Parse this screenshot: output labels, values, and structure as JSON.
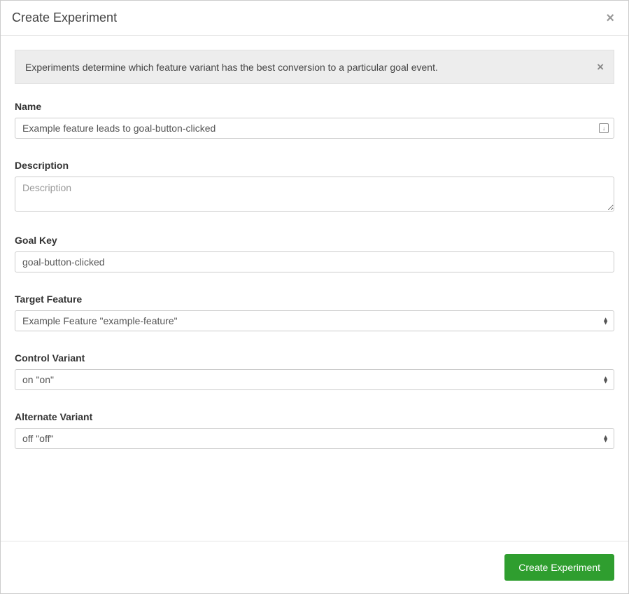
{
  "modal": {
    "title": "Create Experiment"
  },
  "banner": {
    "text": "Experiments determine which feature variant has the best conversion to a particular goal event."
  },
  "form": {
    "name": {
      "label": "Name",
      "value": "Example feature leads to goal-button-clicked"
    },
    "description": {
      "label": "Description",
      "placeholder": "Description",
      "value": ""
    },
    "goalKey": {
      "label": "Goal Key",
      "value": "goal-button-clicked"
    },
    "targetFeature": {
      "label": "Target Feature",
      "value": "Example Feature \"example-feature\""
    },
    "controlVariant": {
      "label": "Control Variant",
      "value": "on \"on\""
    },
    "alternateVariant": {
      "label": "Alternate Variant",
      "value": "off \"off\""
    }
  },
  "footer": {
    "submit": "Create Experiment"
  }
}
